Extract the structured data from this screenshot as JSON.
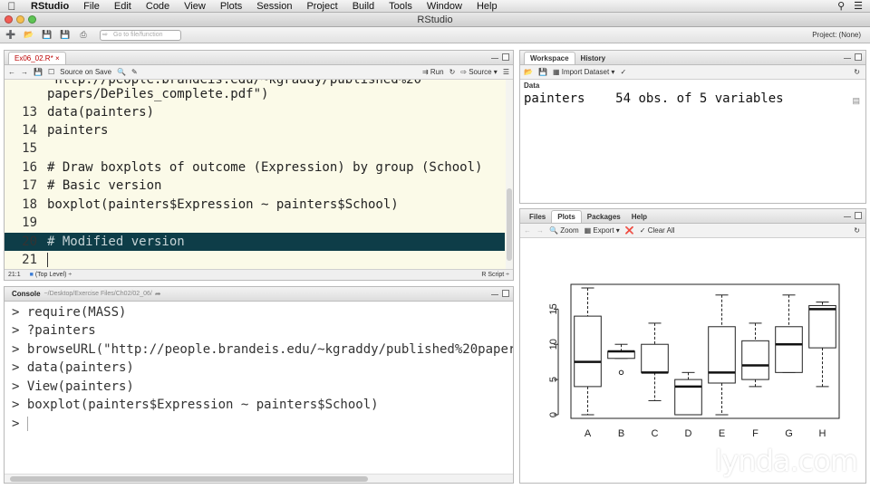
{
  "menubar": {
    "items": [
      "RStudio",
      "File",
      "Edit",
      "Code",
      "View",
      "Plots",
      "Session",
      "Project",
      "Build",
      "Tools",
      "Window",
      "Help"
    ]
  },
  "window": {
    "title": "RStudio"
  },
  "toolbar": {
    "goto_placeholder": "Go to file/function",
    "project": "Project: (None)"
  },
  "editor": {
    "tab": "Ex06_02.R*",
    "source_on_save": "Source on Save",
    "run": "Run",
    "source": "Source",
    "lines": [
      {
        "num": "",
        "text": "papers/DePiles_complete.pdf\")"
      },
      {
        "num": "13",
        "text": "data(painters)"
      },
      {
        "num": "14",
        "text": "painters"
      },
      {
        "num": "15",
        "text": ""
      },
      {
        "num": "16",
        "text": "# Draw boxplots of outcome (Expression) by group (School)"
      },
      {
        "num": "17",
        "text": "# Basic version"
      },
      {
        "num": "18",
        "text": "boxplot(painters$Expression ~ painters$School)"
      },
      {
        "num": "19",
        "text": ""
      },
      {
        "num": "20",
        "text": "# Modified version"
      },
      {
        "num": "21",
        "text": ""
      }
    ],
    "status_pos": "21:1",
    "status_scope": "(Top Level) ÷",
    "status_type": "R Script ÷"
  },
  "console": {
    "tab": "Console",
    "path": "~/Desktop/Exercise Files/Ch02/02_06/",
    "lines": [
      "> require(MASS)",
      "> ?painters",
      "> browseURL(\"http://people.brandeis.edu/~kgraddy/published%20paper",
      "> data(painters)",
      "> View(painters)",
      "> boxplot(painters$Expression ~ painters$School)",
      ">"
    ]
  },
  "workspace": {
    "tabs": [
      "Workspace",
      "History"
    ],
    "import_label": "Import Dataset",
    "section": "Data",
    "row_name": "painters",
    "row_value": "54 obs. of 5 variables"
  },
  "plots": {
    "tabs": [
      "Files",
      "Plots",
      "Packages",
      "Help"
    ],
    "zoom": "Zoom",
    "export": "Export",
    "clear_all": "Clear All"
  },
  "chart_data": {
    "type": "box",
    "categories": [
      "A",
      "B",
      "C",
      "D",
      "E",
      "F",
      "G",
      "H"
    ],
    "ylim": [
      0,
      18
    ],
    "yticks": [
      0,
      5,
      10,
      15
    ],
    "boxes": [
      {
        "min": 0,
        "q1": 4,
        "median": 7.5,
        "q3": 14,
        "max": 18,
        "outliers": []
      },
      {
        "min": 8,
        "q1": 8,
        "median": 9,
        "q3": 9,
        "max": 10,
        "outliers": [
          6
        ]
      },
      {
        "min": 2,
        "q1": 6,
        "median": 6,
        "q3": 10,
        "max": 13,
        "outliers": []
      },
      {
        "min": 0,
        "q1": 0,
        "median": 4,
        "q3": 5,
        "max": 6,
        "outliers": []
      },
      {
        "min": 0,
        "q1": 4.5,
        "median": 6,
        "q3": 12.5,
        "max": 17,
        "outliers": []
      },
      {
        "min": 4,
        "q1": 5,
        "median": 7,
        "q3": 10.5,
        "max": 13,
        "outliers": []
      },
      {
        "min": 6,
        "q1": 6,
        "median": 10,
        "q3": 12.5,
        "max": 17,
        "outliers": []
      },
      {
        "min": 4,
        "q1": 9.5,
        "median": 15,
        "q3": 15.5,
        "max": 16,
        "outliers": []
      }
    ]
  },
  "watermark": "lynda.com"
}
